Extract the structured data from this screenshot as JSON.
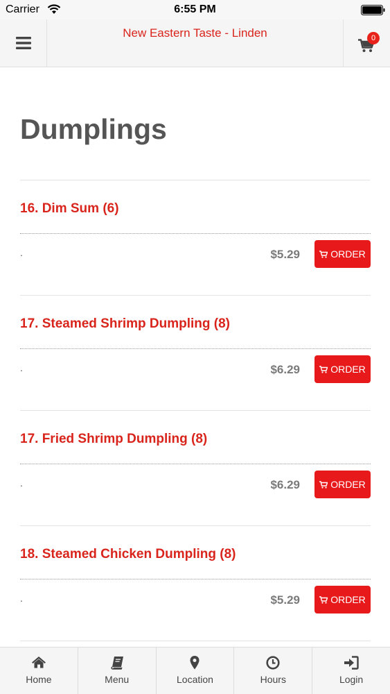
{
  "status_bar": {
    "carrier": "Carrier",
    "time": "6:55 PM"
  },
  "header": {
    "title": "New Eastern Taste - Linden",
    "cart_count": "0"
  },
  "page": {
    "title": "Dumplings"
  },
  "order_label": "ORDER",
  "items": [
    {
      "name": "16. Dim Sum (6)",
      "description": ".",
      "price": "$5.29"
    },
    {
      "name": "17. Steamed Shrimp Dumpling (8)",
      "description": ".",
      "price": "$6.29"
    },
    {
      "name": "17. Fried Shrimp Dumpling (8)",
      "description": ".",
      "price": "$6.29"
    },
    {
      "name": "18. Steamed Chicken Dumpling (8)",
      "description": ".",
      "price": "$5.29"
    }
  ],
  "bottom_nav": [
    {
      "label": "Home",
      "icon": "home-icon"
    },
    {
      "label": "Menu",
      "icon": "book-icon"
    },
    {
      "label": "Location",
      "icon": "map-pin-icon"
    },
    {
      "label": "Hours",
      "icon": "clock-icon"
    },
    {
      "label": "Login",
      "icon": "login-icon"
    }
  ],
  "colors": {
    "accent": "#d9241c",
    "button": "#e8191b",
    "price": "#7a7a7a"
  }
}
